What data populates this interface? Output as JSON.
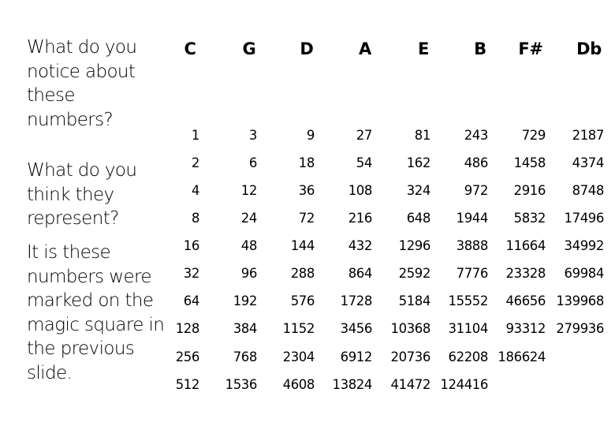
{
  "slide": {
    "question_1": "What do you notice about these numbers?",
    "question_2": "What do you think they represent?",
    "answer": "It is these numbers were marked on the magic square in the previous slide."
  },
  "table": {
    "columns": [
      "C",
      "G",
      "D",
      "A",
      "E",
      "B",
      "F#",
      "Db"
    ],
    "rows": [
      [
        "1",
        "3",
        "9",
        "27",
        "81",
        "243",
        "729",
        "2187"
      ],
      [
        "2",
        "6",
        "18",
        "54",
        "162",
        "486",
        "1458",
        "4374"
      ],
      [
        "4",
        "12",
        "36",
        "108",
        "324",
        "972",
        "2916",
        "8748"
      ],
      [
        "8",
        "24",
        "72",
        "216",
        "648",
        "1944",
        "5832",
        "17496"
      ],
      [
        "16",
        "48",
        "144",
        "432",
        "1296",
        "3888",
        "11664",
        "34992"
      ],
      [
        "32",
        "96",
        "288",
        "864",
        "2592",
        "7776",
        "23328",
        "69984"
      ],
      [
        "64",
        "192",
        "576",
        "1728",
        "5184",
        "15552",
        "46656",
        "139968"
      ],
      [
        "128",
        "384",
        "1152",
        "3456",
        "10368",
        "31104",
        "93312",
        "279936"
      ],
      [
        "256",
        "768",
        "2304",
        "6912",
        "20736",
        "62208",
        "186624",
        ""
      ],
      [
        "512",
        "1536",
        "4608",
        "13824",
        "41472",
        "124416",
        "",
        ""
      ]
    ]
  }
}
